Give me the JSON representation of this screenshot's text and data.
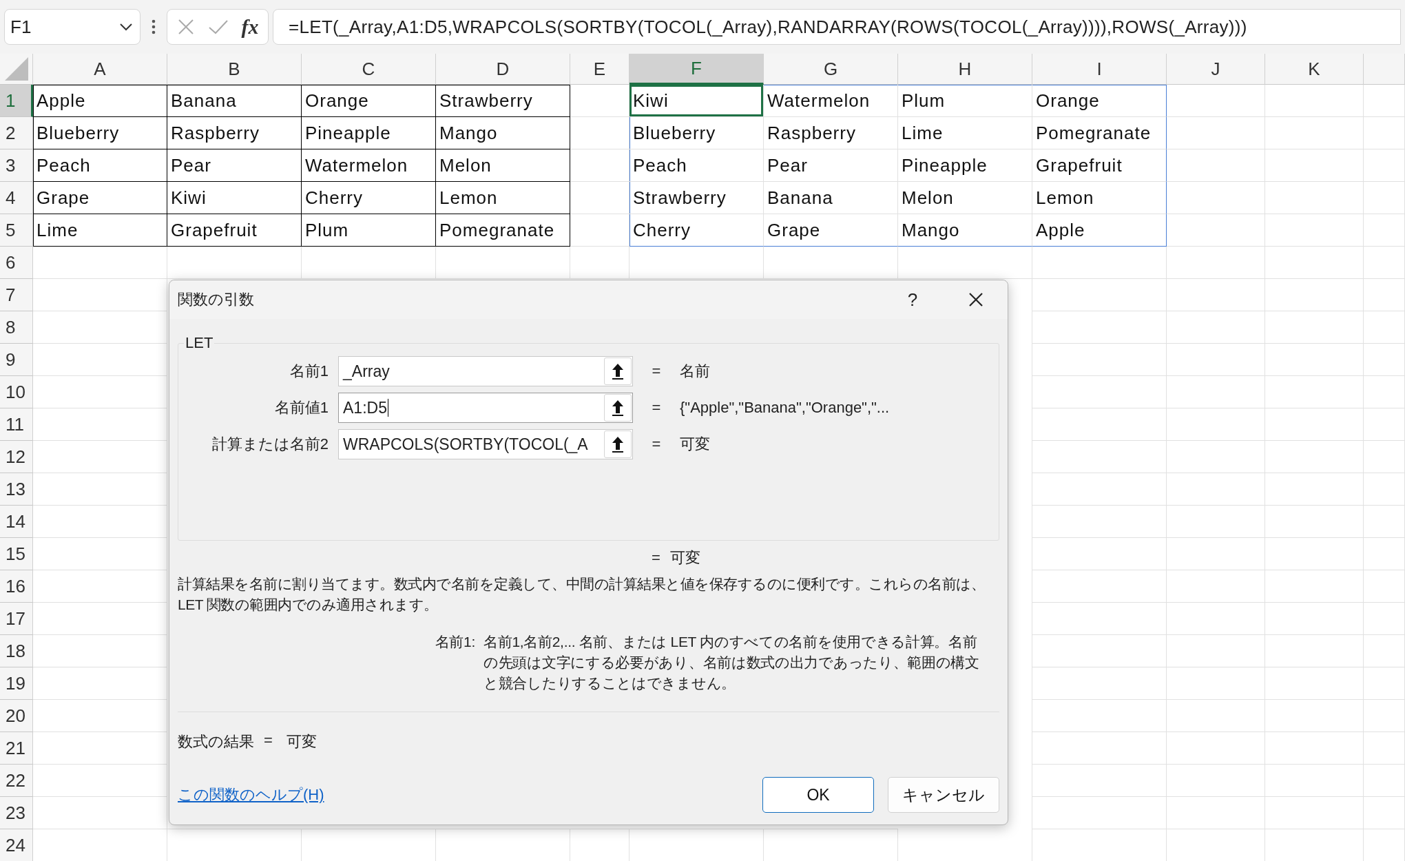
{
  "formula_bar": {
    "name_box": "F1",
    "function_button": "fx",
    "formula": "=LET(_Array,A1:D5,WRAPCOLS(SORTBY(TOCOL(_Array),RANDARRAY(ROWS(TOCOL(_Array)))),ROWS(_Array)))"
  },
  "columns": [
    {
      "label": "A",
      "selected": false
    },
    {
      "label": "B",
      "selected": false
    },
    {
      "label": "C",
      "selected": false
    },
    {
      "label": "D",
      "selected": false
    },
    {
      "label": "E",
      "selected": false
    },
    {
      "label": "F",
      "selected": true
    },
    {
      "label": "G",
      "selected": false
    },
    {
      "label": "H",
      "selected": false
    },
    {
      "label": "I",
      "selected": false
    },
    {
      "label": "J",
      "selected": false
    },
    {
      "label": "K",
      "selected": false
    }
  ],
  "rows": [
    {
      "label": "1",
      "selected": true
    },
    {
      "label": "2",
      "selected": false
    },
    {
      "label": "3",
      "selected": false
    },
    {
      "label": "4",
      "selected": false
    },
    {
      "label": "5",
      "selected": false
    },
    {
      "label": "6",
      "selected": false
    },
    {
      "label": "7",
      "selected": false
    },
    {
      "label": "8",
      "selected": false
    },
    {
      "label": "9",
      "selected": false
    },
    {
      "label": "10",
      "selected": false
    },
    {
      "label": "11",
      "selected": false
    },
    {
      "label": "12",
      "selected": false
    },
    {
      "label": "13",
      "selected": false
    },
    {
      "label": "14",
      "selected": false
    },
    {
      "label": "15",
      "selected": false
    },
    {
      "label": "16",
      "selected": false
    },
    {
      "label": "17",
      "selected": false
    },
    {
      "label": "18",
      "selected": false
    },
    {
      "label": "19",
      "selected": false
    },
    {
      "label": "20",
      "selected": false
    },
    {
      "label": "21",
      "selected": false
    },
    {
      "label": "22",
      "selected": false
    },
    {
      "label": "23",
      "selected": false
    },
    {
      "label": "24",
      "selected": false
    }
  ],
  "source_range": {
    "rows": [
      [
        "Apple",
        "Banana",
        "Orange",
        "Strawberry"
      ],
      [
        "Blueberry",
        "Raspberry",
        "Pineapple",
        "Mango"
      ],
      [
        "Peach",
        "Pear",
        "Watermelon",
        "Melon"
      ],
      [
        "Grape",
        "Kiwi",
        "Cherry",
        "Lemon"
      ],
      [
        "Lime",
        "Grapefruit",
        "Plum",
        "Pomegranate"
      ]
    ]
  },
  "spill_range": {
    "rows": [
      [
        {
          "text": "Kiwi",
          "selected": true
        },
        {
          "text": "Watermelon",
          "selected": false
        },
        {
          "text": "Plum",
          "selected": false
        },
        {
          "text": "Orange",
          "selected": false
        }
      ],
      [
        {
          "text": "Blueberry",
          "selected": false
        },
        {
          "text": "Raspberry",
          "selected": false
        },
        {
          "text": "Lime",
          "selected": false
        },
        {
          "text": "Pomegranate",
          "selected": false
        }
      ],
      [
        {
          "text": "Peach",
          "selected": false
        },
        {
          "text": "Pear",
          "selected": false
        },
        {
          "text": "Pineapple",
          "selected": false
        },
        {
          "text": "Grapefruit",
          "selected": false
        }
      ],
      [
        {
          "text": "Strawberry",
          "selected": false
        },
        {
          "text": "Banana",
          "selected": false
        },
        {
          "text": "Melon",
          "selected": false
        },
        {
          "text": "Lemon",
          "selected": false
        }
      ],
      [
        {
          "text": "Cherry",
          "selected": false
        },
        {
          "text": "Grape",
          "selected": false
        },
        {
          "text": "Mango",
          "selected": false
        },
        {
          "text": "Apple",
          "selected": false
        }
      ]
    ]
  },
  "dialog": {
    "title": "関数の引数",
    "help_button": "?",
    "function_name": "LET",
    "arguments": [
      {
        "label": "名前1",
        "value": "_Array",
        "focused": false,
        "equals": "=",
        "result": "名前"
      },
      {
        "label": "名前値1",
        "value": "A1:D5",
        "focused": true,
        "equals": "=",
        "result": "{\"Apple\",\"Banana\",\"Orange\",\"..."
      },
      {
        "label": "計算または名前2",
        "value": "WRAPCOLS(SORTBY(TOCOL(_A",
        "focused": false,
        "equals": "=",
        "result": "可変"
      }
    ],
    "function_result": {
      "equals": "=",
      "value": "可変"
    },
    "description": "計算結果を名前に割り当てます。数式内で名前を定義して、中間の計算結果と値を保存するのに便利です。これらの名前は、LET 関数の範囲内でのみ適用されます。",
    "argument_help": {
      "name": "名前1:",
      "text": "名前1,名前2,... 名前、または LET 内のすべての名前を使用できる計算。名前の先頭は文字にする必要があり、名前は数式の出力であったり、範囲の構文と競合したりすることはできません。"
    },
    "formula_result": {
      "label": "数式の結果",
      "equals": "=",
      "value": "可変"
    },
    "help_link": "この関数のヘルプ(H)",
    "buttons": [
      {
        "label": "OK",
        "kind": "primary"
      },
      {
        "label": "キャンセル",
        "kind": "secondary"
      }
    ]
  }
}
